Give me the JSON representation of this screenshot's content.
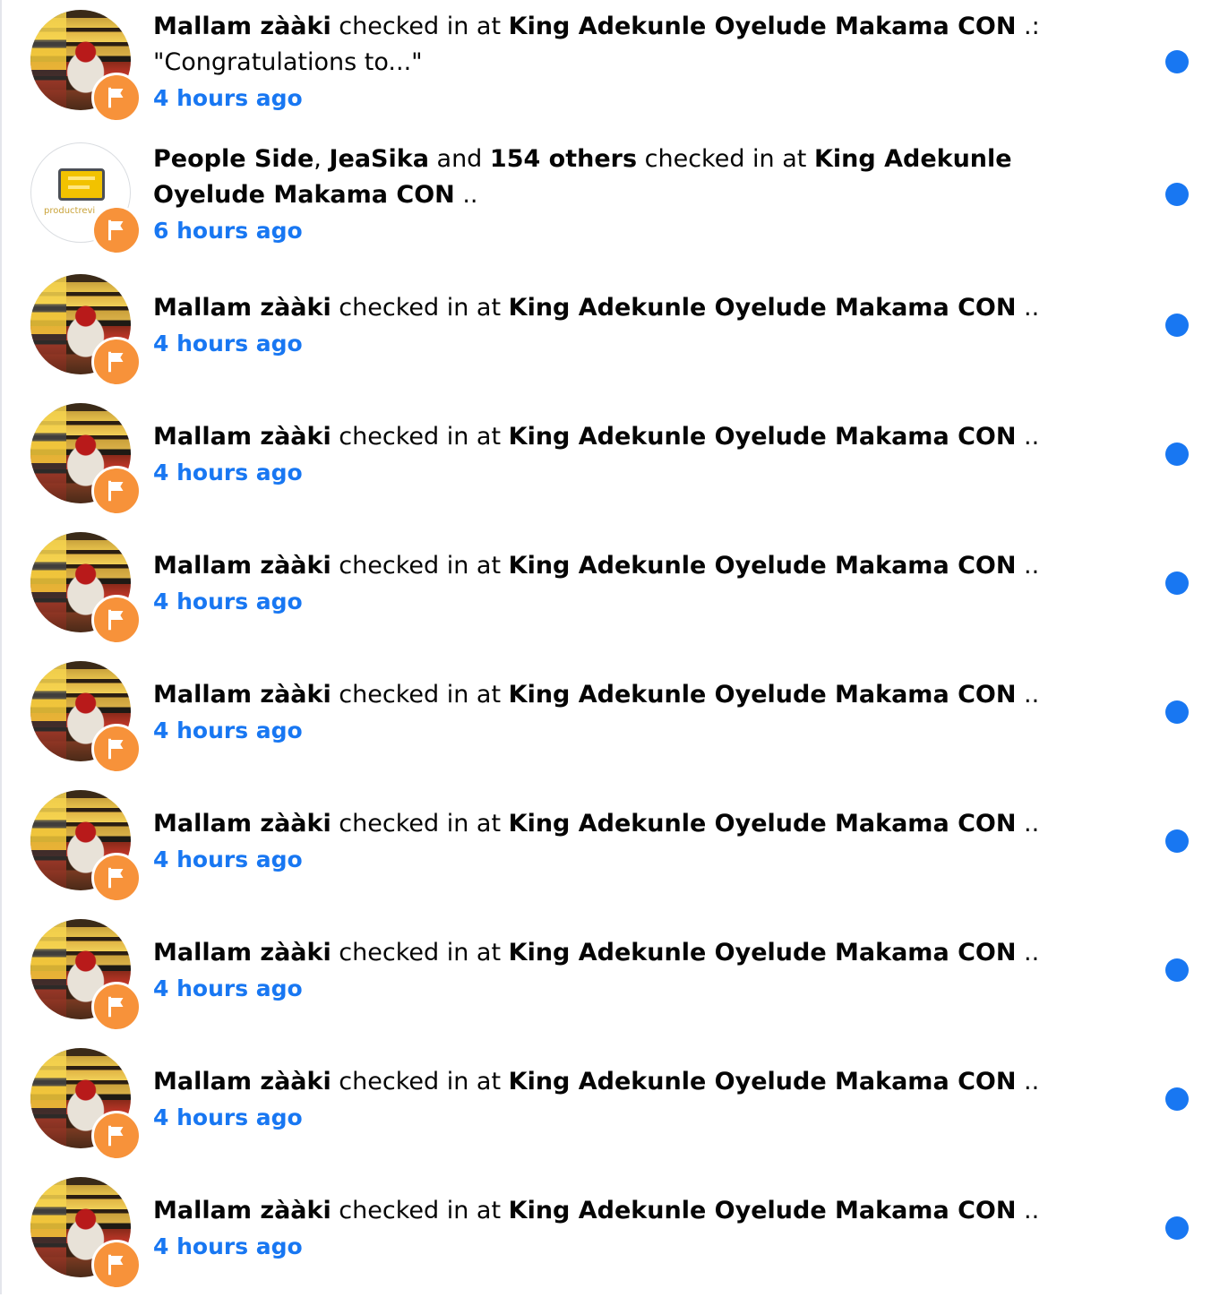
{
  "notifications": [
    {
      "actor": "Mallam zààki",
      "verb": " checked in at ",
      "place": "King Adekunle Oyelude Makama CON",
      "tail": " .: \"Congratulations to...\"",
      "time": "4 hours ago",
      "avatar": "user-photo",
      "unread": true
    },
    {
      "actor": "People Side",
      "sep1": ", ",
      "actor2": "JeaSika",
      "sep2": " and ",
      "actor3": "154 others",
      "verb": " checked in at ",
      "place": "King Adekunle Oyelude Makama CON",
      "tail": " ..",
      "time": "6 hours ago",
      "avatar": "page-logo",
      "logo_text": "productrevi",
      "unread": true
    },
    {
      "actor": "Mallam zààki",
      "verb": " checked in at ",
      "place": "King Adekunle Oyelude Makama CON",
      "tail": " ..",
      "time": "4 hours ago",
      "avatar": "user-photo",
      "unread": true
    },
    {
      "actor": "Mallam zààki",
      "verb": " checked in at ",
      "place": "King Adekunle Oyelude Makama CON",
      "tail": " ..",
      "time": "4 hours ago",
      "avatar": "user-photo",
      "unread": true
    },
    {
      "actor": "Mallam zààki",
      "verb": " checked in at ",
      "place": "King Adekunle Oyelude Makama CON",
      "tail": " ..",
      "time": "4 hours ago",
      "avatar": "user-photo",
      "unread": true
    },
    {
      "actor": "Mallam zààki",
      "verb": " checked in at ",
      "place": "King Adekunle Oyelude Makama CON",
      "tail": " ..",
      "time": "4 hours ago",
      "avatar": "user-photo",
      "unread": true
    },
    {
      "actor": "Mallam zààki",
      "verb": " checked in at ",
      "place": "King Adekunle Oyelude Makama CON",
      "tail": " ..",
      "time": "4 hours ago",
      "avatar": "user-photo",
      "unread": true
    },
    {
      "actor": "Mallam zààki",
      "verb": " checked in at ",
      "place": "King Adekunle Oyelude Makama CON",
      "tail": " ..",
      "time": "4 hours ago",
      "avatar": "user-photo",
      "unread": true
    },
    {
      "actor": "Mallam zààki",
      "verb": " checked in at ",
      "place": "King Adekunle Oyelude Makama CON",
      "tail": " ..",
      "time": "4 hours ago",
      "avatar": "user-photo",
      "unread": true
    },
    {
      "actor": "Mallam zààki",
      "verb": " checked in at ",
      "place": "King Adekunle Oyelude Makama CON",
      "tail": " ..",
      "time": "4 hours ago",
      "avatar": "user-photo",
      "unread": true
    }
  ],
  "badge_icon": "checkin-flag-icon",
  "colors": {
    "accent": "#1877f2",
    "badge": "#f7923a",
    "text": "#050505"
  }
}
